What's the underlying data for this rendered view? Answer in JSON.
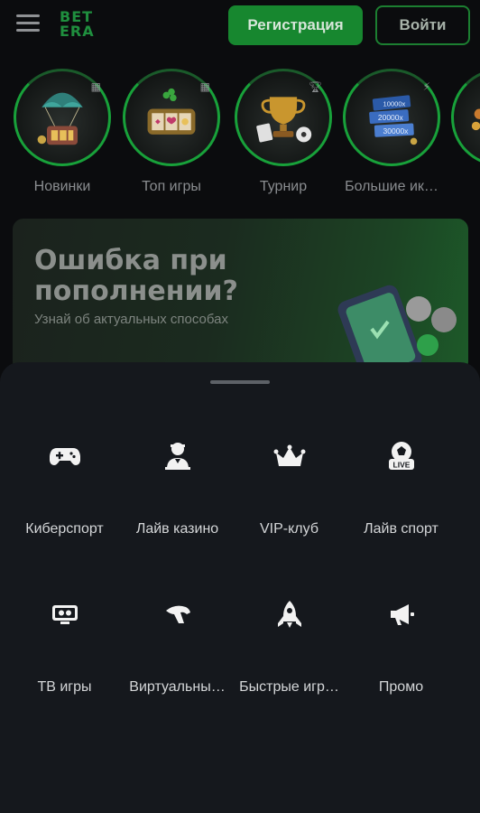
{
  "header": {
    "logo_line1": "BET",
    "logo_line2": "ERA",
    "register_label": "Регистрация",
    "login_label": "Войти"
  },
  "categories": [
    {
      "label": "Новинки",
      "icon": "parachute-slot-icon"
    },
    {
      "label": "Топ игры",
      "icon": "slot-machine-icon"
    },
    {
      "label": "Турнир",
      "icon": "trophy-icon"
    },
    {
      "label": "Большие ик…",
      "icon": "multiplier-tickets-icon",
      "tickets": [
        "10000x",
        "20000x",
        "30000x"
      ]
    }
  ],
  "banner": {
    "title": "Ошибка при пополнении?",
    "subtitle": "Узнай об актуальных способах"
  },
  "menu": [
    {
      "label": "Киберспорт",
      "icon": "gamepad-icon"
    },
    {
      "label": "Лайв казино",
      "icon": "dealer-icon"
    },
    {
      "label": "VIP-клуб",
      "icon": "crown-icon"
    },
    {
      "label": "Лайв спорт",
      "icon": "live-ball-icon",
      "badge": "LIVE"
    },
    {
      "label": "ТВ игры",
      "icon": "tv-icon"
    },
    {
      "label": "Виртуальны…",
      "icon": "horse-head-icon"
    },
    {
      "label": "Быстрые игр…",
      "icon": "rocket-icon"
    },
    {
      "label": "Промо",
      "icon": "megaphone-icon"
    }
  ],
  "colors": {
    "accent": "#17872f",
    "background": "#0b0c0e",
    "sheet": "#15181d"
  }
}
